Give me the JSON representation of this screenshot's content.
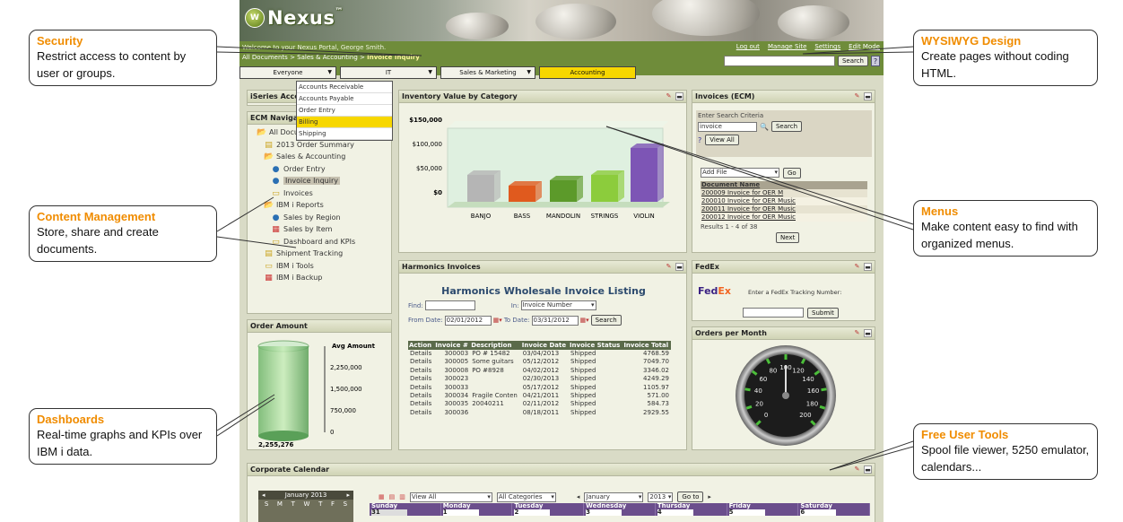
{
  "app": {
    "logo_text": "Nexus",
    "logo_mark": "W",
    "trademark": "™"
  },
  "topbar": {
    "welcome": "Welcome to your Nexus Portal, George Smith.",
    "breadcrumb": [
      "All Documents",
      ">",
      "Sales & Accounting",
      ">",
      "Invoice Inquiry"
    ],
    "links": [
      "Log out",
      "Manage Site",
      "Settings",
      "Edit Mode"
    ],
    "search_button": "Search",
    "help": "?"
  },
  "menus": [
    {
      "label": "Everyone"
    },
    {
      "label": "IT"
    },
    {
      "label": "Sales & Marketing"
    },
    {
      "label": "Accounting"
    }
  ],
  "accounting_menu": [
    "Accounts Receivable",
    "Accounts Payable",
    "Order Entry",
    "Billing",
    "Shipping"
  ],
  "accounting_selected": "Billing",
  "panels": {
    "iseries": "iSeries Access",
    "ecm_nav": "ECM Navigator",
    "inventory": "Inventory Value by Category",
    "invoices_ecm": "Invoices (ECM)",
    "harmonics": "Harmonics Invoices",
    "fedex": "FedEx",
    "order_amount": "Order Amount",
    "orders_month": "Orders per Month",
    "calendar": "Corporate Calendar"
  },
  "tree": [
    "All Documents",
    "2013 Order Summary",
    "Sales & Accounting",
    "Order Entry",
    "Invoice Inquiry",
    "Invoices",
    "IBM i Reports",
    "Sales by Region",
    "Sales by Item",
    "Dashboard and KPIs",
    "Shipment Tracking",
    "IBM i Tools",
    "IBM i Backup"
  ],
  "chart_data": [
    {
      "type": "bar",
      "title": "",
      "categories": [
        "BANJO",
        "BASS",
        "MANDOLIN",
        "STRINGS",
        "VIOLIN"
      ],
      "values": [
        50000,
        30000,
        40000,
        50000,
        100000
      ],
      "ytick_labels": [
        "$150,000",
        "$100,000",
        "$50,000",
        "$0"
      ],
      "ylim": [
        0,
        150000
      ],
      "colors": [
        "#b5b5b5",
        "#e05a1e",
        "#5c9a2a",
        "#8ccc3c",
        "#7d55b5"
      ]
    },
    {
      "type": "bar",
      "title": "",
      "series": [
        {
          "name": "Avg Amount",
          "values": [
            2255276
          ]
        }
      ],
      "ytick_labels": [
        "2,250,000",
        "1,500,000",
        "750,000",
        "0"
      ],
      "data_label": "2,255,276",
      "ylim": [
        0,
        3000000
      ]
    }
  ],
  "ecm": {
    "criteria_label": "Enter Search Criteria",
    "query": "invoice",
    "search": "Search",
    "view_all": "View All",
    "add_file": "Add File",
    "go": "Go",
    "doc_header": "Document Name",
    "docs": [
      "200009 Invoice for OER M",
      "200010 Invoice for OER Music",
      "200011 Invoice for OER Music",
      "200012 Invoice for OER Music"
    ],
    "results": "Results 1 - 4 of 38",
    "next": "Next"
  },
  "harmonics": {
    "title": "Harmonics Wholesale Invoice Listing",
    "find": "Find:",
    "in": "In:",
    "in_value": "Invoice Number",
    "from": "From Date:",
    "from_value": "02/01/2012",
    "to": "To Date:",
    "to_value": "03/31/2012",
    "search": "Search",
    "columns": [
      "Action",
      "Invoice #",
      "Description",
      "Invoice Date",
      "Invoice Status",
      "Invoice Total"
    ],
    "rows": [
      [
        "Details",
        "300003",
        "PO # 15482",
        "03/04/2013",
        "Shipped",
        "4768.59"
      ],
      [
        "Details",
        "300005",
        "Some guitars",
        "05/12/2012",
        "Shipped",
        "7049.70"
      ],
      [
        "Details",
        "300008",
        "PO #8928",
        "04/02/2012",
        "Shipped",
        "3346.02"
      ],
      [
        "Details",
        "300023",
        "",
        "02/30/2013",
        "Shipped",
        "4249.29"
      ],
      [
        "Details",
        "300033",
        "",
        "05/17/2012",
        "Shipped",
        "1105.97"
      ],
      [
        "Details",
        "300034",
        "Fragile Conten",
        "04/21/2011",
        "Shipped",
        "571.00"
      ],
      [
        "Details",
        "300035",
        "20040211",
        "02/11/2012",
        "Shipped",
        "584.73"
      ],
      [
        "Details",
        "300036",
        "",
        "08/18/2011",
        "Shipped",
        "2929.55"
      ]
    ]
  },
  "fedex": {
    "logo_fed": "Fed",
    "logo_ex": "Ex",
    "label": "Enter a FedEx Tracking Number:",
    "submit": "Submit"
  },
  "gauge": {
    "value": 100,
    "labels": [
      "20",
      "40",
      "60",
      "80",
      "100",
      "120",
      "140",
      "160",
      "180",
      "200",
      "0"
    ]
  },
  "calendar": {
    "month_year": "January  2013",
    "days_short": [
      "S",
      "M",
      "T",
      "W",
      "T",
      "F",
      "S"
    ],
    "view": "View All",
    "cats": "All Categories",
    "month": "January",
    "year": "2013",
    "goto": "Go to",
    "weekdays": [
      "Sunday",
      "Monday",
      "Tuesday",
      "Wednesday",
      "Thursday",
      "Friday",
      "Saturday"
    ],
    "dates": [
      "31",
      "1",
      "2",
      "3",
      "4",
      "5",
      "6"
    ]
  },
  "annotations": [
    {
      "title": "Security",
      "desc": "Restrict access to content by user or groups."
    },
    {
      "title": "Content Management",
      "desc": "Store, share and create documents."
    },
    {
      "title": "Dashboards",
      "desc": "Real-time  graphs and KPIs over IBM i data."
    },
    {
      "title": "WYSIWYG Design",
      "desc": "Create pages without coding HTML."
    },
    {
      "title": "Menus",
      "desc": "Make content easy to find with organized menus."
    },
    {
      "title": "Free User Tools",
      "desc": "Spool file viewer, 5250 emulator, calendars..."
    }
  ]
}
